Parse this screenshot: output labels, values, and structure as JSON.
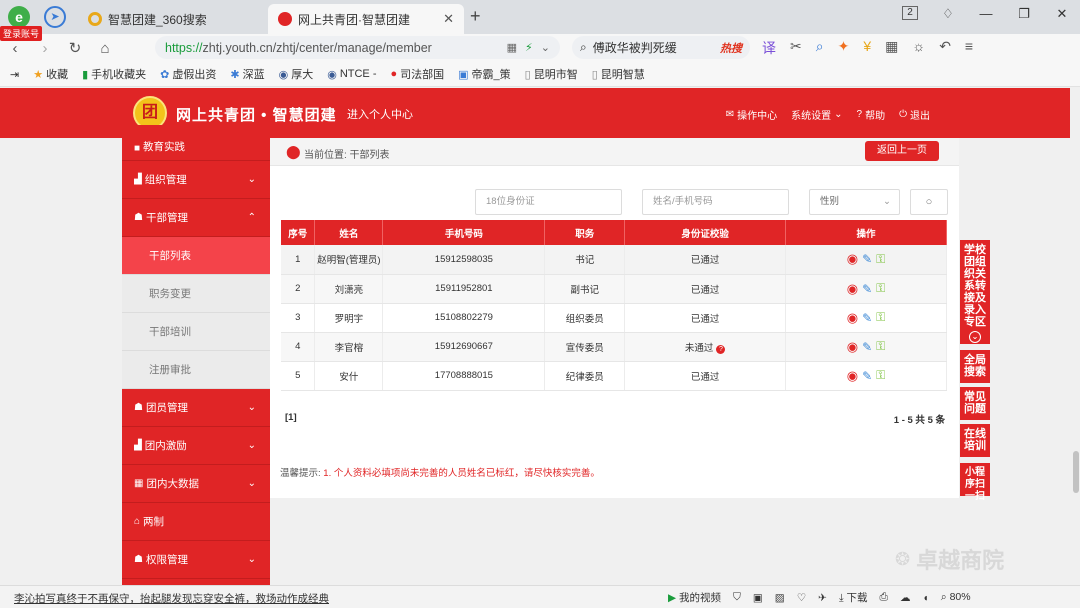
{
  "browser": {
    "login_badge": "登录账号",
    "tabs": [
      {
        "title": "智慧团建_360搜索"
      },
      {
        "title": "网上共青团·智慧团建"
      }
    ],
    "url_secure": "https://",
    "url_rest": "zhtj.youth.cn/zhtj/center/manage/member",
    "search_placeholder": "傅政华被判死缓",
    "search_hot": "热搜",
    "tab_count": "2",
    "bookmarks": [
      "收藏",
      "手机收藏夹",
      "虚假出资",
      "深蓝",
      "厚大",
      "NTCE -",
      "司法部国",
      "帝霸_策",
      "昆明市智",
      "昆明智慧"
    ]
  },
  "header": {
    "brand": "网上共青团 • 智慧团建",
    "personal_center": "进入个人中心",
    "nav": [
      "操作中心",
      "系统设置",
      "帮助",
      "退出"
    ]
  },
  "sidebar": {
    "items": [
      {
        "label": "教育实践",
        "icon": "book-icon"
      },
      {
        "label": "组织管理",
        "icon": "org-icon"
      },
      {
        "label": "干部管理",
        "icon": "people-icon"
      },
      {
        "label": "团员管理",
        "icon": "people-icon"
      },
      {
        "label": "团内激励",
        "icon": "org-icon"
      },
      {
        "label": "团内大数据",
        "icon": "grid-icon"
      },
      {
        "label": "两制",
        "icon": "home-icon"
      },
      {
        "label": "权限管理",
        "icon": "people-icon"
      }
    ],
    "sub_items": [
      "干部列表",
      "职务变更",
      "干部培训",
      "注册审批"
    ]
  },
  "content": {
    "breadcrumb": "当前位置: 干部列表",
    "back_button": "返回上一页",
    "filters": {
      "id_placeholder": "18位身份证",
      "name_placeholder": "姓名/手机号码",
      "gender_label": "性别"
    },
    "table": {
      "headers": [
        "序号",
        "姓名",
        "手机号码",
        "职务",
        "身份证校验",
        "操作"
      ],
      "rows": [
        {
          "no": "1",
          "name": "赵明智(管理员)",
          "phone": "15912598035",
          "role": "书记",
          "check": "已通过"
        },
        {
          "no": "2",
          "name": "刘潇亮",
          "phone": "15911952801",
          "role": "副书记",
          "check": "已通过"
        },
        {
          "no": "3",
          "name": "罗明宇",
          "phone": "15108802279",
          "role": "组织委员",
          "check": "已通过"
        },
        {
          "no": "4",
          "name": "李官榕",
          "phone": "15912690667",
          "role": "宣传委员",
          "check": "未通过"
        },
        {
          "no": "5",
          "name": "安什",
          "phone": "17708888015",
          "role": "纪律委员",
          "check": "已通过"
        }
      ]
    },
    "pager_left": "[1]",
    "pager_right": "1 - 5  共 5 条",
    "tip_label": "温馨提示:",
    "tip_message": "1. 个人资料必填项尚未完善的人员姓名已标红，请尽快核实完善。"
  },
  "float_panel": [
    "学校团组织关系转接及录入专区",
    "全局搜索",
    "常见问题",
    "在线培训",
    "小程序扫一扫"
  ],
  "watermark": "卓越商院",
  "statusbar": {
    "news": "李沁拍写真终于不再保守，抬起腿发现忘穿安全裤，救场动作成经典",
    "items": [
      "我的视频",
      "下载",
      "80%"
    ]
  },
  "colors": {
    "brand_red": "#e02526",
    "name_warning": "#e02526"
  }
}
